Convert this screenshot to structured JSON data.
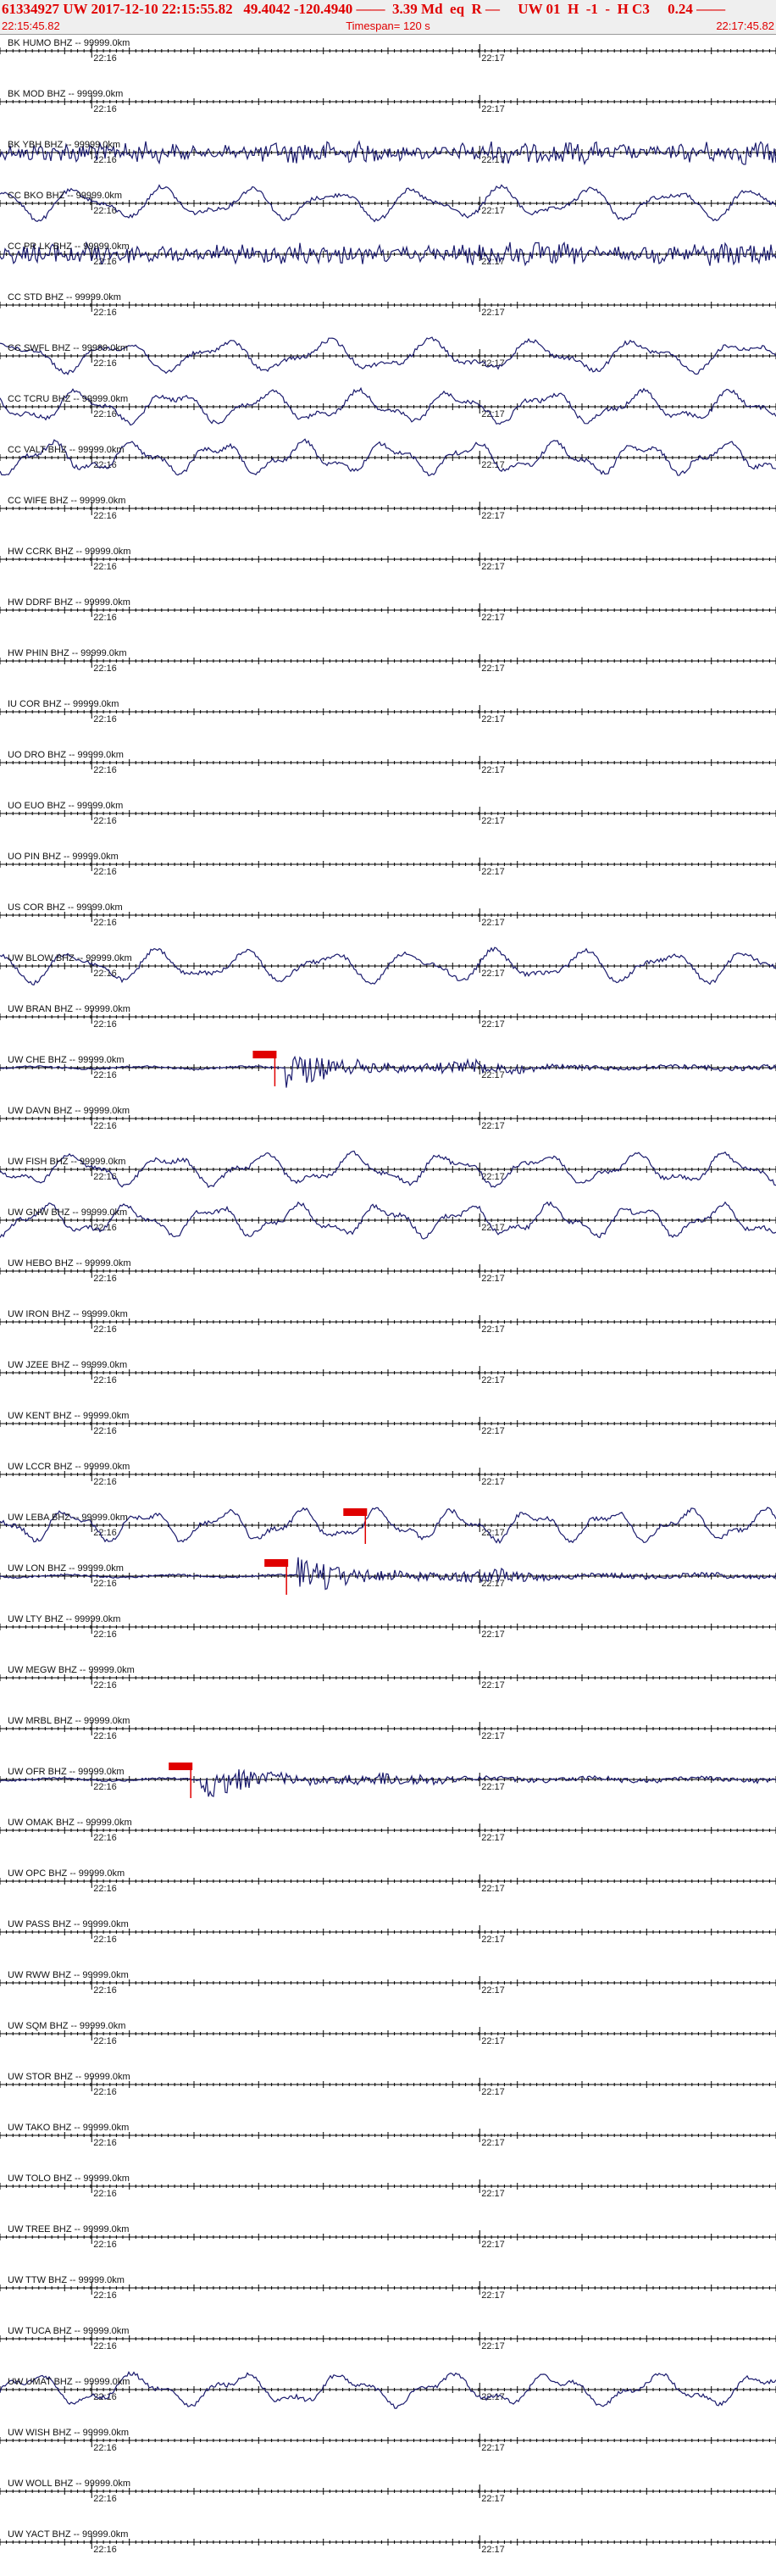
{
  "header": {
    "title": "61334927 UW 2017-12-10 22:15:55.82   49.4042 -120.4940 ——  3.39 Md  eq  R —     UW 01  H  -1  -  H C3     0.24 ——",
    "start_time": "22:15:45.82",
    "timespan": "Timespan= 120 s",
    "end_time": "22:17:45.82"
  },
  "colors": {
    "trace": "#1b1b6e",
    "axis": "#000000",
    "pick": "#e00000",
    "header_text": "#e00000",
    "header_bg": "#efefef"
  },
  "chart_data": {
    "type": "line",
    "title": "61334927 UW 2017-12-10 22:15:55.82   49.4042 -120.4940 ——  3.39 Md  eq  R —     UW 01  H  -1  -  H C3     0.24 ——",
    "x_start": "22:15:45.82",
    "x_end": "22:17:45.82",
    "timespan_s": 120,
    "time_marks": [
      "22:16",
      "22:17"
    ],
    "channels": [
      {
        "label": "BK HUMO BHZ -- 99999.0km",
        "signal": "flat"
      },
      {
        "label": "BK MOD BHZ -- 99999.0km",
        "signal": "flat"
      },
      {
        "label": "BK YBH BHZ -- 99999.0km",
        "signal": "noise"
      },
      {
        "label": "CC BKO BHZ -- 99999.0km",
        "signal": "wave"
      },
      {
        "label": "CC PR LK BHZ -- 99999.0km",
        "signal": "noise"
      },
      {
        "label": "CC STD BHZ -- 99999.0km",
        "signal": "flat"
      },
      {
        "label": "CC SWFL BHZ -- 99999.0km",
        "signal": "wave"
      },
      {
        "label": "CC TCRU BHZ -- 99999.0km",
        "signal": "wave"
      },
      {
        "label": "CC VALT BHZ -- 99999.0km",
        "signal": "wave"
      },
      {
        "label": "CC WIFE BHZ -- 99999.0km",
        "signal": "flat"
      },
      {
        "label": "HW CCRK BHZ -- 99999.0km",
        "signal": "flat"
      },
      {
        "label": "HW DDRF BHZ -- 99999.0km",
        "signal": "flat"
      },
      {
        "label": "HW PHIN BHZ -- 99999.0km",
        "signal": "flat"
      },
      {
        "label": "IU COR BHZ -- 99999.0km",
        "signal": "flat"
      },
      {
        "label": "UO DRO BHZ -- 99999.0km",
        "signal": "flat"
      },
      {
        "label": "UO EUO BHZ -- 99999.0km",
        "signal": "flat"
      },
      {
        "label": "UO PIN BHZ -- 99999.0km",
        "signal": "flat"
      },
      {
        "label": "US COR BHZ -- 99999.0km",
        "signal": "flat"
      },
      {
        "label": "UW BLOW BHZ -- 99999.0km",
        "signal": "wave"
      },
      {
        "label": "UW BRAN BHZ -- 99999.0km",
        "signal": "flat"
      },
      {
        "label": "UW CHE BHZ -- 99999.0km",
        "signal": "event"
      },
      {
        "label": "UW DAVN BHZ -- 99999.0km",
        "signal": "flat"
      },
      {
        "label": "UW FISH BHZ -- 99999.0km",
        "signal": "wave"
      },
      {
        "label": "UW GNW BHZ -- 99999.0km",
        "signal": "wave"
      },
      {
        "label": "UW HEBO BHZ -- 99999.0km",
        "signal": "flat"
      },
      {
        "label": "UW IRON BHZ -- 99999.0km",
        "signal": "flat"
      },
      {
        "label": "UW JZEE BHZ -- 99999.0km",
        "signal": "flat"
      },
      {
        "label": "UW KENT BHZ -- 99999.0km",
        "signal": "flat"
      },
      {
        "label": "UW LCCR BHZ -- 99999.0km",
        "signal": "flat"
      },
      {
        "label": "UW LEBA BHZ -- 99999.0km",
        "signal": "wave"
      },
      {
        "label": "UW LON BHZ -- 99999.0km",
        "signal": "event"
      },
      {
        "label": "UW LTY BHZ -- 99999.0km",
        "signal": "flat"
      },
      {
        "label": "UW MEGW BHZ -- 99999.0km",
        "signal": "flat"
      },
      {
        "label": "UW MRBL BHZ -- 99999.0km",
        "signal": "flat"
      },
      {
        "label": "UW OFR BHZ -- 99999.0km",
        "signal": "event"
      },
      {
        "label": "UW OMAK BHZ -- 99999.0km",
        "signal": "flat"
      },
      {
        "label": "UW OPC BHZ -- 99999.0km",
        "signal": "flat"
      },
      {
        "label": "UW PASS BHZ -- 99999.0km",
        "signal": "flat"
      },
      {
        "label": "UW RWW BHZ -- 99999.0km",
        "signal": "flat"
      },
      {
        "label": "UW SQM BHZ -- 99999.0km",
        "signal": "flat"
      },
      {
        "label": "UW STOR BHZ -- 99999.0km",
        "signal": "flat"
      },
      {
        "label": "UW TAKO BHZ -- 99999.0km",
        "signal": "flat"
      },
      {
        "label": "UW TOLO BHZ -- 99999.0km",
        "signal": "flat"
      },
      {
        "label": "UW TREE BHZ -- 99999.0km",
        "signal": "flat"
      },
      {
        "label": "UW TTW BHZ -- 99999.0km",
        "signal": "flat"
      },
      {
        "label": "UW TUCA BHZ -- 99999.0km",
        "signal": "flat"
      },
      {
        "label": "UW UMAT BHZ -- 99999.0km",
        "signal": "wave"
      },
      {
        "label": "UW WISH BHZ -- 99999.0km",
        "signal": "flat"
      },
      {
        "label": "UW WOLL BHZ -- 99999.0km",
        "signal": "flat"
      },
      {
        "label": "UW YACT BHZ -- 99999.0km",
        "signal": "flat"
      }
    ],
    "picks": [
      {
        "channel": "UW CHE BHZ -- 99999.0km",
        "time_s": 42.5
      },
      {
        "channel": "UW LEBA BHZ -- 99999.0km",
        "time_s": 56.5
      },
      {
        "channel": "UW LON BHZ -- 99999.0km",
        "time_s": 44.3
      },
      {
        "channel": "UW OFR BHZ -- 99999.0km",
        "time_s": 29.5
      }
    ]
  }
}
